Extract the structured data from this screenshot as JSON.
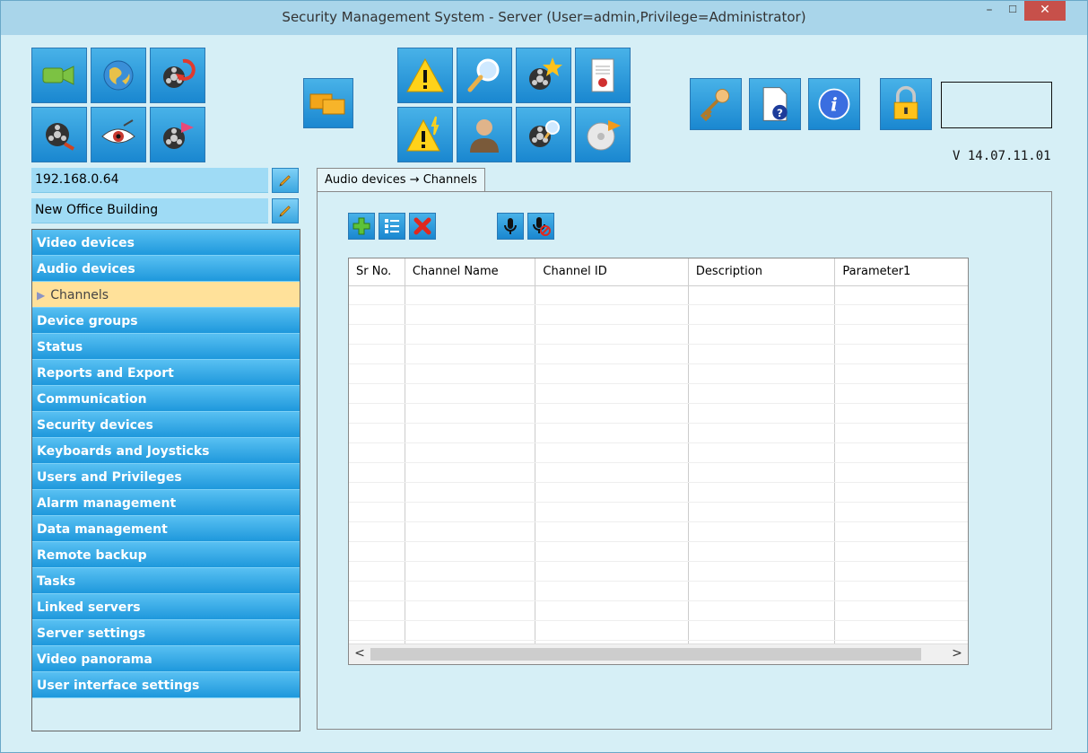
{
  "window": {
    "title": "Security Management System - Server (User=admin,Privilege=Administrator)",
    "min_glyph": "–",
    "max_glyph": "☐",
    "close_glyph": "✕"
  },
  "toolbar": {
    "buttons": [
      {
        "icon": "camera-icon"
      },
      {
        "icon": "globe-icon"
      },
      {
        "icon": "film-refresh-icon"
      },
      {
        "icon": "film-reel-icon"
      },
      {
        "icon": "eye-icon"
      },
      {
        "icon": "film-export-icon"
      },
      {
        "icon": "windows-icon"
      },
      {
        "icon": "warning-icon"
      },
      {
        "icon": "magnifier-icon"
      },
      {
        "icon": "film-star-icon"
      },
      {
        "icon": "report-icon"
      },
      {
        "icon": "warning-flash-icon"
      },
      {
        "icon": "user-icon"
      },
      {
        "icon": "film-search-icon"
      },
      {
        "icon": "disc-export-icon"
      },
      {
        "icon": "key-icon"
      },
      {
        "icon": "help-document-icon"
      },
      {
        "icon": "info-icon"
      },
      {
        "icon": "lock-icon"
      }
    ]
  },
  "version": "V 14.07.11.01",
  "server": {
    "ip": "192.168.0.64",
    "site": "New Office Building"
  },
  "nav": {
    "items": [
      {
        "label": "Video devices"
      },
      {
        "label": "Audio devices"
      },
      {
        "label": "Channels",
        "selected": true
      },
      {
        "label": "Device groups"
      },
      {
        "label": "Status"
      },
      {
        "label": "Reports and Export"
      },
      {
        "label": "Communication"
      },
      {
        "label": "Security devices"
      },
      {
        "label": "Keyboards and Joysticks"
      },
      {
        "label": "Users and Privileges"
      },
      {
        "label": "Alarm management"
      },
      {
        "label": "Data management"
      },
      {
        "label": "Remote backup"
      },
      {
        "label": "Tasks"
      },
      {
        "label": "Linked servers"
      },
      {
        "label": "Server settings"
      },
      {
        "label": "Video panorama"
      },
      {
        "label": "User interface settings"
      }
    ]
  },
  "tab": {
    "label": "Audio devices → Channels"
  },
  "actions": [
    {
      "icon": "add-icon"
    },
    {
      "icon": "list-icon"
    },
    {
      "icon": "delete-icon"
    },
    {
      "icon": "microphone-icon"
    },
    {
      "icon": "microphone-off-icon"
    }
  ],
  "grid": {
    "columns": [
      "Sr No.",
      "Channel Name",
      "Channel ID",
      "Description",
      "Parameter1"
    ],
    "scroll_left": "<",
    "scroll_right": ">"
  },
  "colors": {
    "accent": "#1e98dc",
    "selected": "#ffe19a",
    "background": "#d6eff6",
    "close": "#c7504a"
  }
}
